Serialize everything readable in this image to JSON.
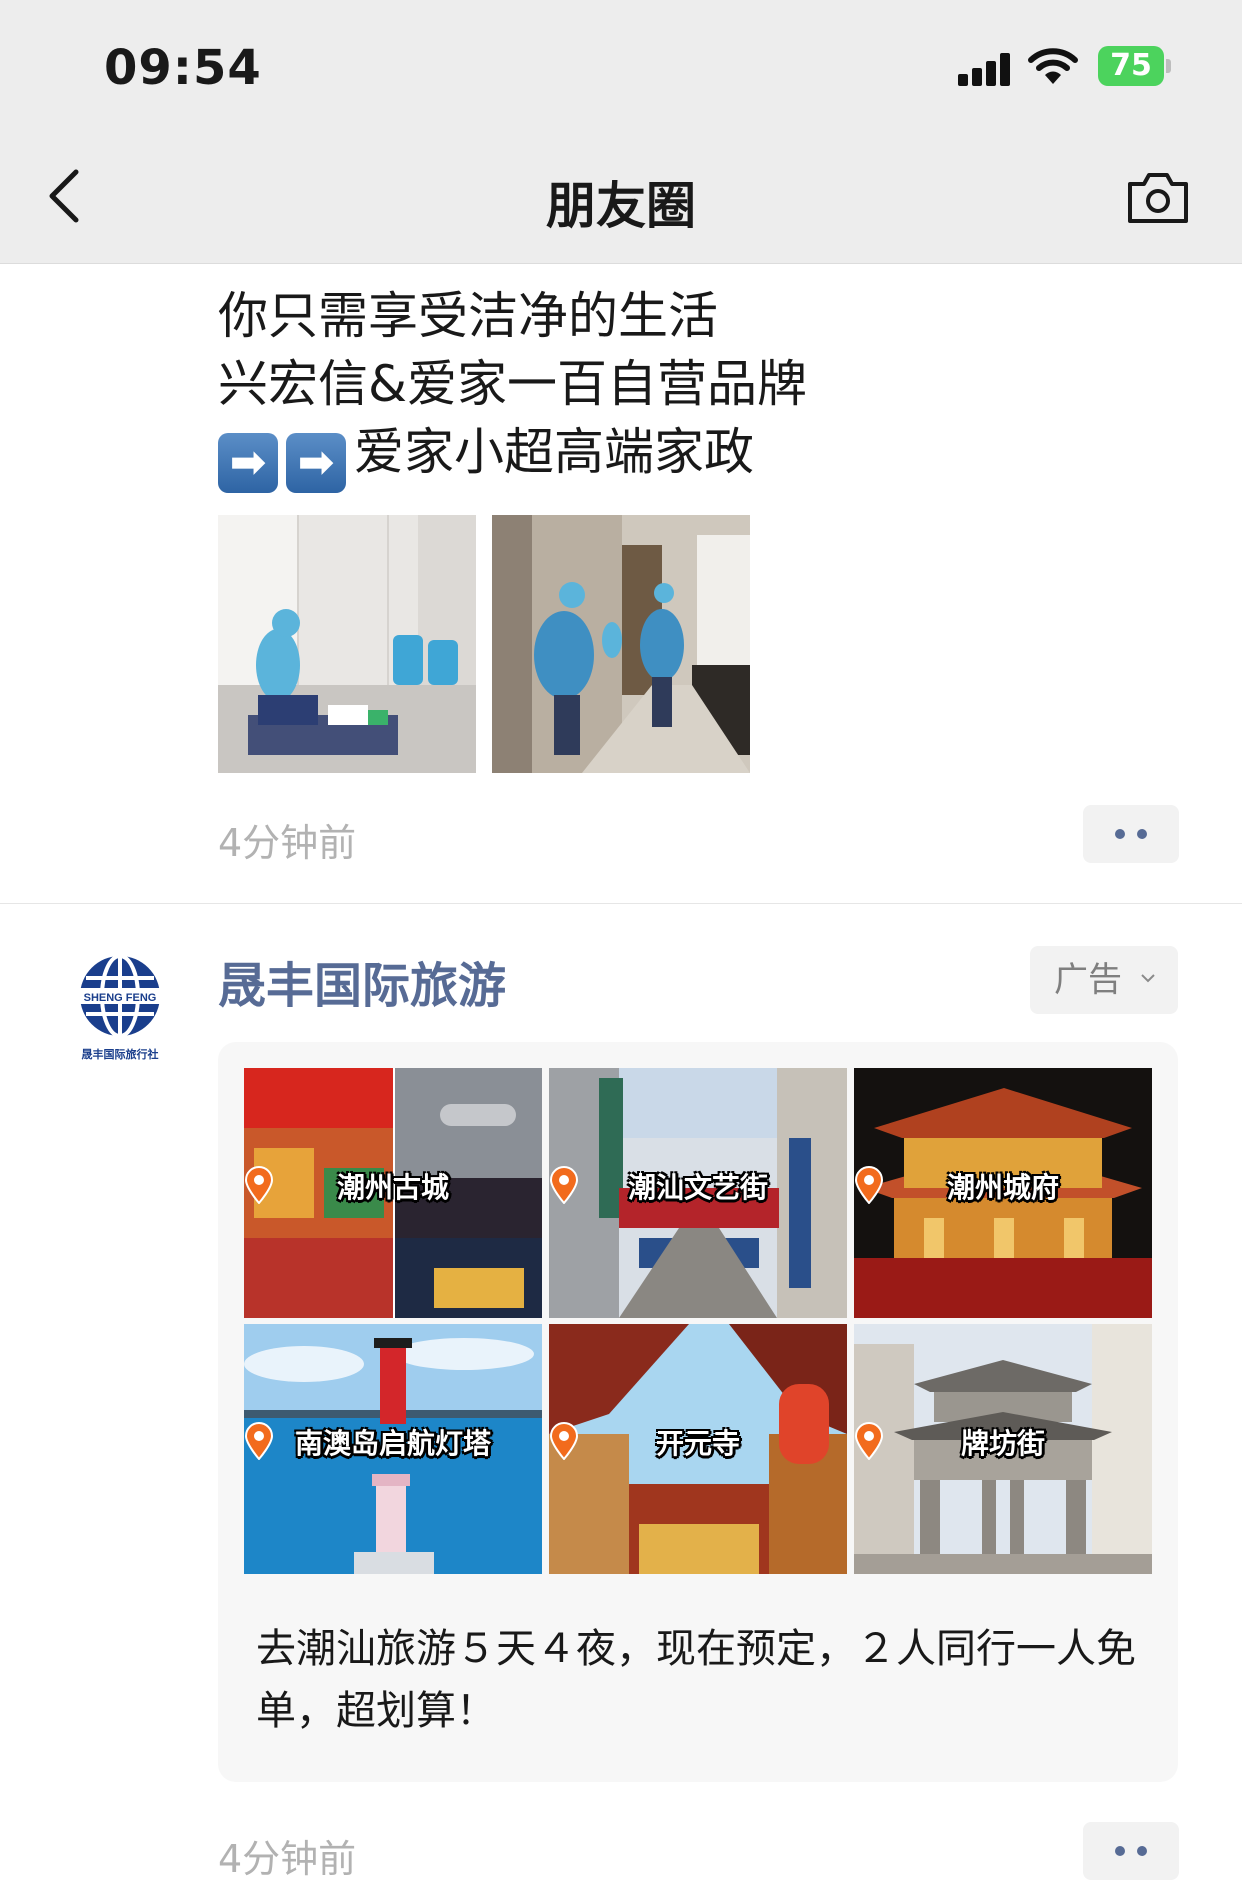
{
  "status_bar": {
    "time": "09:54",
    "battery": "75"
  },
  "nav": {
    "title": "朋友圈"
  },
  "post1": {
    "lines": [
      "你只需享受洁净的生活",
      "兴宏信&爱家一百自营品牌"
    ],
    "arrow_line": {
      "arrows": [
        "➡",
        "➡"
      ],
      "text": "爱家小超高端家政"
    },
    "timestamp": "4分钟前"
  },
  "ad_post": {
    "logo_text": "SHENG FENG",
    "logo_caption": "晟丰国际旅行社",
    "author": "晟丰国际旅游",
    "ad_label": "广告",
    "tiles": [
      {
        "label": "潮州古城",
        "scene": "chaozhou-ancient-city-collage"
      },
      {
        "label": "潮汕文艺街",
        "scene": "arts-street"
      },
      {
        "label": "潮州城府",
        "scene": "city-tower-night"
      },
      {
        "label": "南澳岛启航灯塔",
        "scene": "lighthouse-sea"
      },
      {
        "label": "开元寺",
        "scene": "kaiyuan-temple"
      },
      {
        "label": "牌坊街",
        "scene": "memorial-archway-street"
      }
    ],
    "text": "去潮汕旅游５天４夜，现在预定，２人同行一人免单，超划算！",
    "timestamp": "4分钟前"
  },
  "colors": {
    "link_blue": "#576b95",
    "pin_orange": "#f26b1d",
    "battery_green": "#4cd35d"
  }
}
